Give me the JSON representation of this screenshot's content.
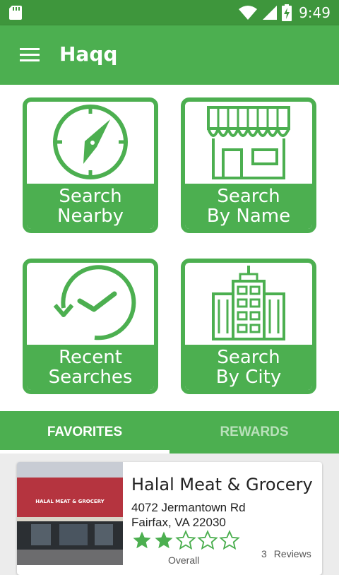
{
  "status_bar": {
    "time": "9:49",
    "icons": [
      "sd-card-icon",
      "wifi-icon",
      "signal-icon",
      "battery-charging-icon"
    ]
  },
  "app_bar": {
    "title": "Haqq",
    "menu_icon": "hamburger-menu-icon"
  },
  "tiles": [
    {
      "line1": "Search",
      "line2": "Nearby",
      "icon": "compass-icon"
    },
    {
      "line1": "Search",
      "line2": "By Name",
      "icon": "storefront-icon"
    },
    {
      "line1": "Recent",
      "line2": "Searches",
      "icon": "history-clock-icon"
    },
    {
      "line1": "Search",
      "line2": "By City",
      "icon": "city-building-icon"
    }
  ],
  "tabs": {
    "favorites": "FAVORITES",
    "rewards": "REWARDS",
    "active": "favorites"
  },
  "favorites": [
    {
      "name": "Halal Meat & Grocery",
      "address_line1": "4072 Jermantown Rd",
      "address_line2": "Fairfax, VA 22030",
      "rating": 2,
      "rating_max": 5,
      "review_count": "3",
      "reviews_label": "Reviews",
      "overall_label": "Overall",
      "storefront_sign": "HALAL MEAT & GROCERY"
    }
  ],
  "colors": {
    "primary": "#4caf50",
    "primary_dark": "#3e963c",
    "tab_inactive": "#b9e0ba"
  }
}
